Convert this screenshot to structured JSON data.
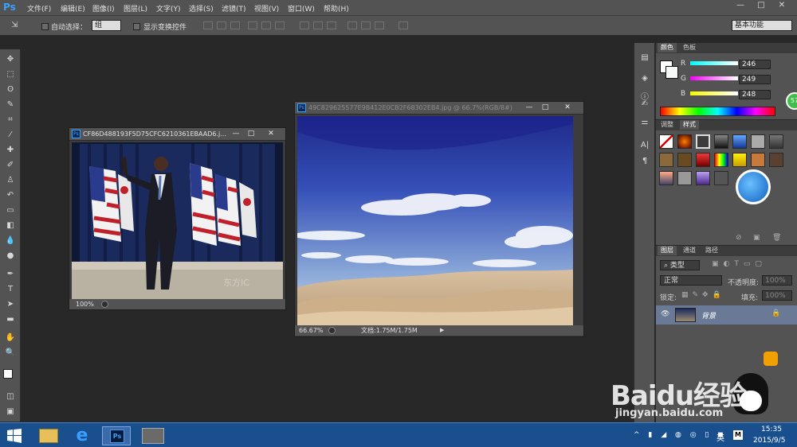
{
  "app": {
    "logo": "Ps"
  },
  "menu": [
    "文件(F)",
    "编辑(E)",
    "图像(I)",
    "图层(L)",
    "文字(Y)",
    "选择(S)",
    "滤镜(T)",
    "视图(V)",
    "窗口(W)",
    "帮助(H)"
  ],
  "window_controls": {
    "minimize": "—",
    "restore": "□",
    "close": "✕"
  },
  "options": {
    "auto_select_label": "自动选择：",
    "auto_select_value": "组",
    "show_transform_label": "显示变换控件",
    "workspace": "基本功能"
  },
  "doc1": {
    "title": "CF86D488193F5D75CFC6210361EBAAD6.j...",
    "zoom": "100%",
    "watermark": "东方IC"
  },
  "doc2": {
    "title": "49C829625577E9B412E0CB2F68302EB4.jpg @ 66.7%(RGB/8#)",
    "zoom": "66.67%",
    "doc_size": "文档:1.75M/1.75M"
  },
  "color_panel": {
    "tabs": [
      "颜色",
      "色板"
    ],
    "channels": [
      {
        "label": "R",
        "value": "246"
      },
      {
        "label": "G",
        "value": "249"
      },
      {
        "label": "B",
        "value": "248"
      }
    ],
    "badge": "57"
  },
  "styles_panel": {
    "tabs": [
      "调整",
      "样式"
    ]
  },
  "layers_panel": {
    "tabs": [
      "图层",
      "通道",
      "路径"
    ],
    "filter_kind": "类型",
    "blend_mode": "正常",
    "opacity_label": "不透明度:",
    "opacity_value": "100%",
    "lock_label": "锁定:",
    "fill_label": "填充:",
    "fill_value": "100%",
    "layer_name": "背景"
  },
  "watermark": {
    "brand": "Baidu经验",
    "url": "jingyan.baidu.com"
  },
  "taskbar": {
    "time": "15:35",
    "date": "2015/9/5",
    "ime": "英"
  },
  "colors": {
    "taskbar": "#1a4f8e",
    "panel": "#535353",
    "accent": "#3aa0ff"
  }
}
